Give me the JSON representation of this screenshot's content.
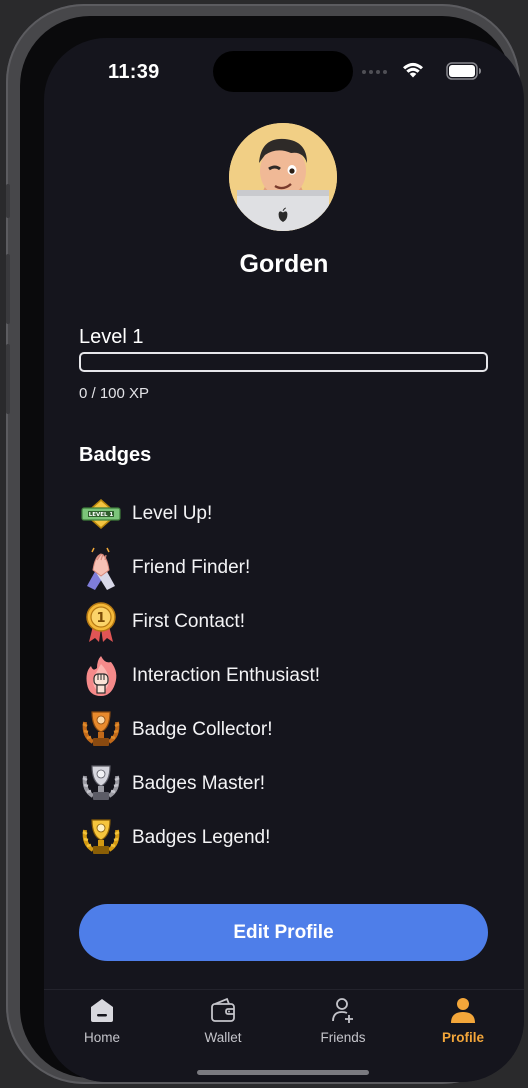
{
  "status_bar": {
    "time": "11:39"
  },
  "profile": {
    "name": "Gorden"
  },
  "level": {
    "label": "Level 1",
    "xp_text": "0 / 100 XP",
    "progress_percent": 0
  },
  "badges": {
    "title": "Badges",
    "items": [
      {
        "label": "Level Up!",
        "icon": "level-badge-icon"
      },
      {
        "label": "Friend Finder!",
        "icon": "handshake-icon"
      },
      {
        "label": "First Contact!",
        "icon": "first-place-medal-icon"
      },
      {
        "label": "Interaction Enthusiast!",
        "icon": "fist-fire-icon"
      },
      {
        "label": "Badge Collector!",
        "icon": "bronze-trophy-icon"
      },
      {
        "label": "Badges Master!",
        "icon": "silver-trophy-icon"
      },
      {
        "label": "Badges Legend!",
        "icon": "gold-trophy-icon"
      }
    ]
  },
  "edit_button": {
    "label": "Edit Profile"
  },
  "tabbar": {
    "items": [
      {
        "label": "Home",
        "icon": "home-icon"
      },
      {
        "label": "Wallet",
        "icon": "wallet-icon"
      },
      {
        "label": "Friends",
        "icon": "add-friend-icon"
      },
      {
        "label": "Profile",
        "icon": "person-icon",
        "active": true
      }
    ]
  },
  "colors": {
    "accent": "#4e7ee9",
    "active_tab": "#f3a63a",
    "background": "#15151d"
  }
}
